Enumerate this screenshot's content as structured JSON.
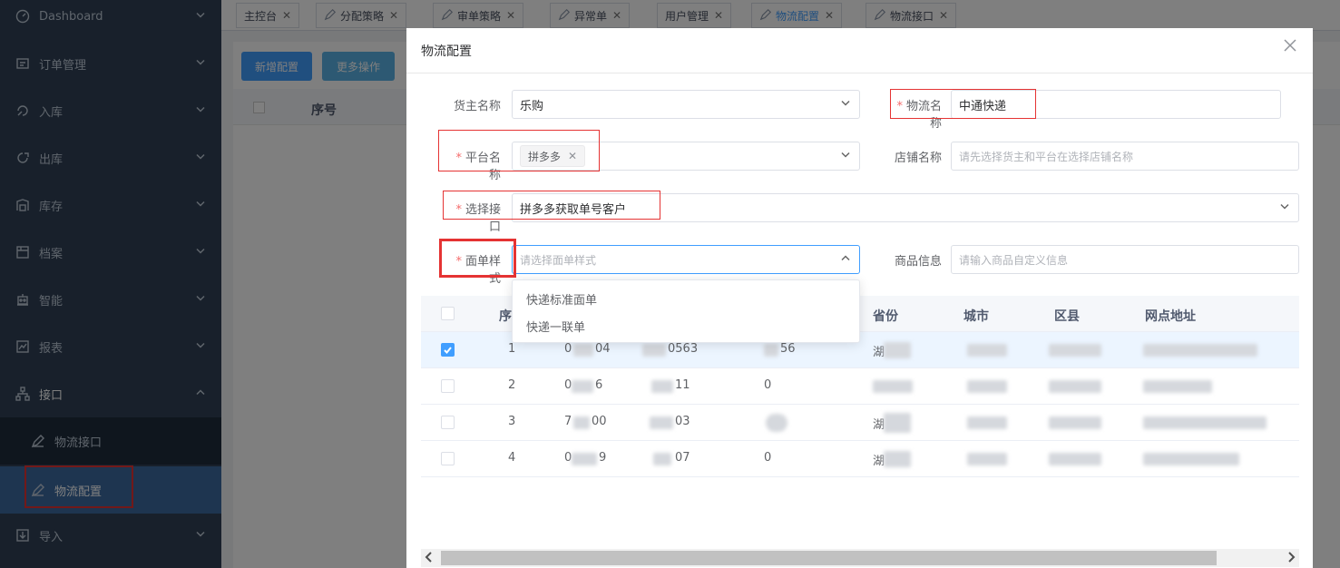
{
  "sidebar": {
    "items": [
      {
        "label": "Dashboard",
        "icon": "dashboard-icon"
      },
      {
        "label": "订单管理",
        "icon": "order-icon"
      },
      {
        "label": "入库",
        "icon": "inbound-icon"
      },
      {
        "label": "出库",
        "icon": "outbound-icon"
      },
      {
        "label": "库存",
        "icon": "inventory-icon"
      },
      {
        "label": "档案",
        "icon": "archive-icon"
      },
      {
        "label": "智能",
        "icon": "robot-icon"
      },
      {
        "label": "报表",
        "icon": "report-icon"
      },
      {
        "label": "接口",
        "icon": "interface-icon"
      },
      {
        "label": "导入",
        "icon": "import-icon"
      }
    ],
    "subitems": [
      {
        "label": "物流接口",
        "icon": "edit-icon"
      },
      {
        "label": "物流配置",
        "icon": "edit-icon",
        "active": true
      }
    ]
  },
  "tabs": [
    {
      "label": "主控台"
    },
    {
      "label": "分配策略"
    },
    {
      "label": "审单策略"
    },
    {
      "label": "异常单"
    },
    {
      "label": "用户管理"
    },
    {
      "label": "物流配置",
      "active": true
    },
    {
      "label": "物流接口"
    }
  ],
  "toolbar": {
    "add_label": "新增配置",
    "more_label": "更多操作"
  },
  "bg_table": {
    "index_header": "序号"
  },
  "modal": {
    "title": "物流配置",
    "fields": {
      "owner_label": "货主名称",
      "owner_value": "乐购",
      "logistics_label": "物流名称",
      "logistics_value": "中通快递",
      "platform_label": "平台名称",
      "platform_tag": "拼多多",
      "shop_label": "店铺名称",
      "shop_placeholder": "请先选择货主和平台在选择店铺名称",
      "api_label": "选择接口",
      "api_value": "拼多多获取单号客户",
      "style_label": "面单样式",
      "style_placeholder": "请选择面单样式",
      "goods_label": "商品信息",
      "goods_placeholder": "请输入商品自定义信息"
    },
    "dropdown_options": [
      "快递标准面单",
      "快递一联单"
    ],
    "table": {
      "headers": {
        "index": "序",
        "province": "省份",
        "city": "城市",
        "district": "区县",
        "address": "网点地址"
      },
      "rows": [
        {
          "index": "1",
          "c1": "0",
          "c1b": "04",
          "c2": "0563",
          "c3": "56",
          "prov": "湖",
          "checked": true
        },
        {
          "index": "2",
          "c1": "0",
          "c1b": "6",
          "c2": "11",
          "c3": "0",
          "prov": "",
          "checked": false
        },
        {
          "index": "3",
          "c1": "7",
          "c1b": "00",
          "c2": "03",
          "c3": "",
          "prov": "湖",
          "checked": false
        },
        {
          "index": "4",
          "c1": "0",
          "c1b": "9",
          "c2": "07",
          "c3": "0",
          "prov": "湖",
          "checked": false
        }
      ]
    }
  },
  "colors": {
    "sidebar_bg": "#304156",
    "sidebar_active": "#3d6aa0",
    "primary": "#409eff",
    "highlight_box": "#e53333",
    "required": "#f56c6c"
  }
}
